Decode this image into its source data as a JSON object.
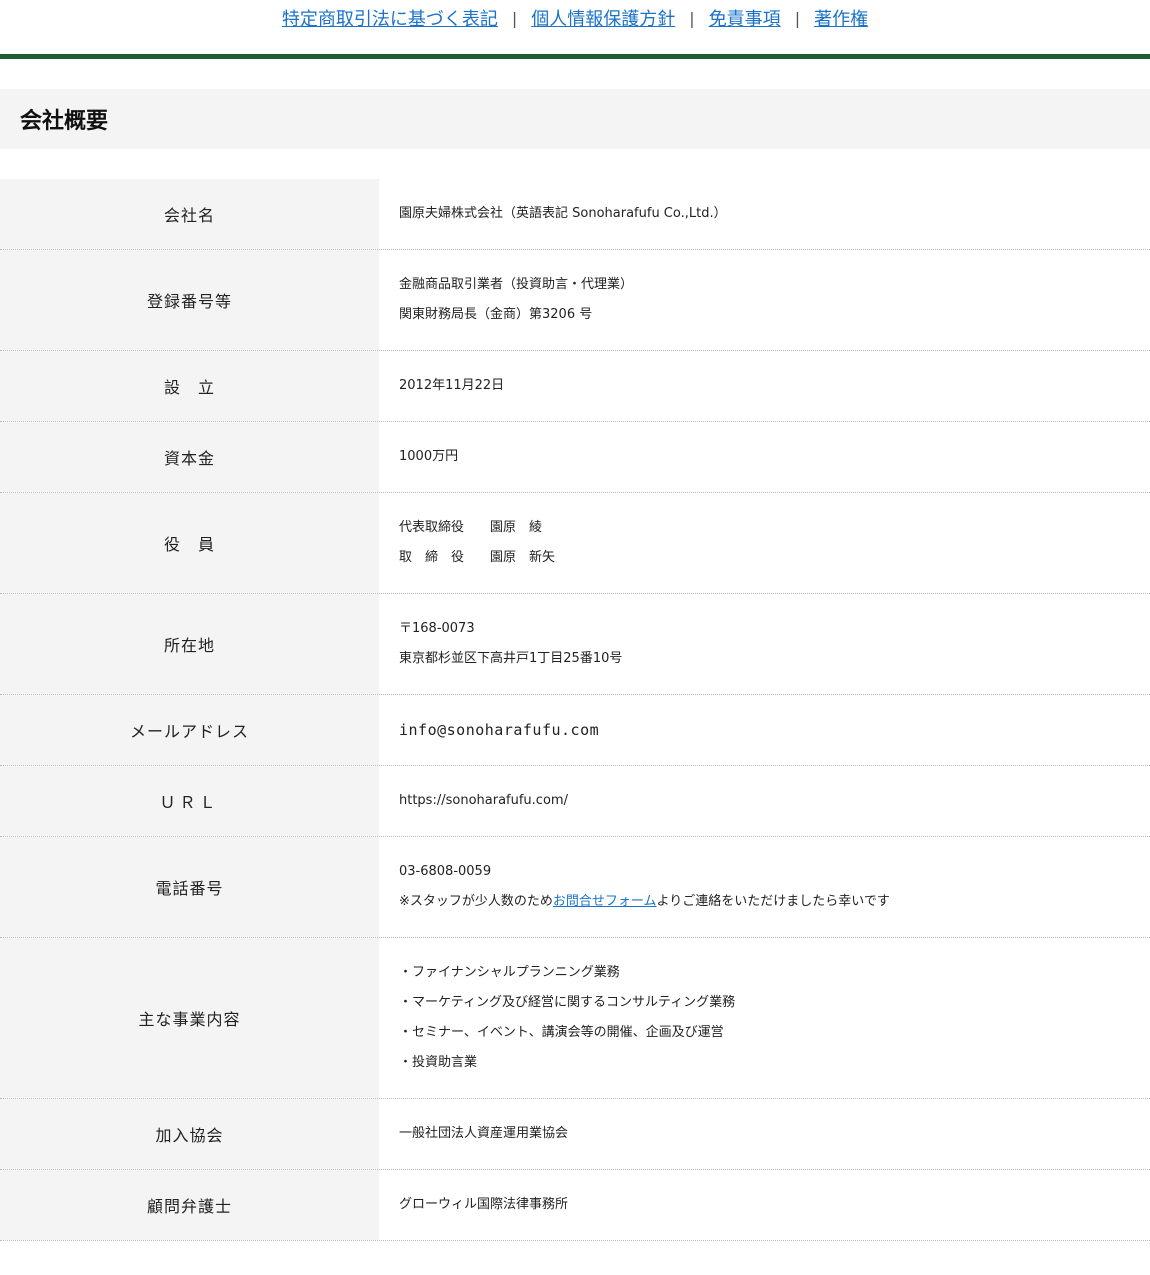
{
  "nav": {
    "links": [
      "特定商取引法に基づく表記",
      "個人情報保護方針",
      "免責事項",
      "著作権"
    ],
    "separator": "|"
  },
  "section": {
    "title": "会社概要"
  },
  "profile": {
    "company_name": {
      "label": "会社名",
      "value": "園原夫婦株式会社（英語表記 Sonoharafufu Co.,Ltd.）"
    },
    "registration": {
      "label": "登録番号等",
      "lines": [
        "金融商品取引業者（投資助言・代理業）",
        "関東財務局長（金商）第3206 号"
      ]
    },
    "established": {
      "label": "設　立",
      "value": "2012年11月22日"
    },
    "capital": {
      "label": "資本金",
      "value": "1000万円"
    },
    "officers": {
      "label": "役　員",
      "lines": [
        "代表取締役　　園原　綾",
        "取　締　役　　園原　新矢"
      ]
    },
    "address": {
      "label": "所在地",
      "lines": [
        "〒168-0073",
        "東京都杉並区下高井戸1丁目25番10号"
      ]
    },
    "email": {
      "label": "メールアドレス",
      "value": "info@sonoharafufu.com"
    },
    "url": {
      "label": "ＵＲＬ",
      "value": "https://sonoharafufu.com/"
    },
    "phone": {
      "label": "電話番号",
      "number": "03-6808-0059",
      "note_prefix": "※スタッフが少人数のため",
      "note_link": "お問合せフォーム",
      "note_suffix": "よりご連絡をいただけましたら幸いです"
    },
    "business": {
      "label": "主な事業内容",
      "lines": [
        "・ファイナンシャルプランニング業務",
        "・マーケティング及び経営に関するコンサルティング業務",
        "・セミナー、イベント、講演会等の開催、企画及び運営",
        "・投資助言業"
      ]
    },
    "association": {
      "label": "加入協会",
      "value": "一般社団法人資産運用業協会"
    },
    "lawyer": {
      "label": "顧問弁護士",
      "value": "グローウィル国際法律事務所"
    }
  }
}
